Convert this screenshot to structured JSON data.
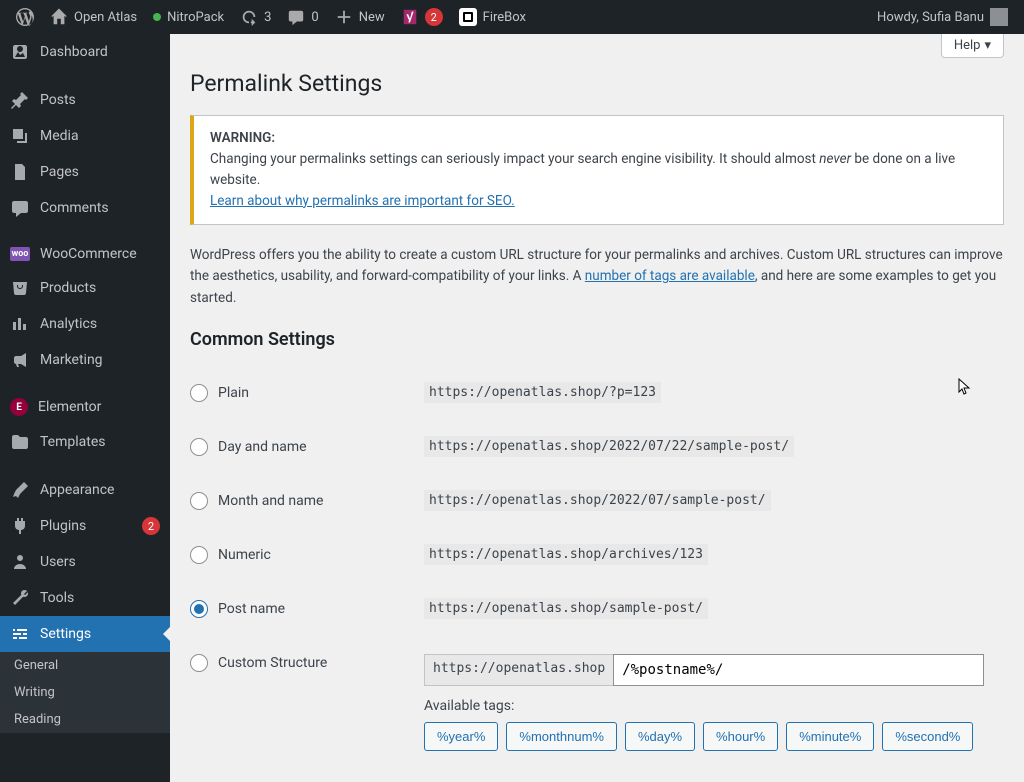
{
  "adminbar": {
    "site_name": "Open Atlas",
    "nitro": "NitroPack",
    "updates": "3",
    "comments": "0",
    "new": "New",
    "yoast_badge": "2",
    "firebox": "FireBox",
    "howdy": "Howdy, Sufia Banu"
  },
  "sidebar": {
    "dashboard": "Dashboard",
    "posts": "Posts",
    "media": "Media",
    "pages": "Pages",
    "comments": "Comments",
    "woocommerce": "WooCommerce",
    "products": "Products",
    "analytics": "Analytics",
    "marketing": "Marketing",
    "elementor": "Elementor",
    "templates": "Templates",
    "appearance": "Appearance",
    "plugins": "Plugins",
    "plugins_count": "2",
    "users": "Users",
    "tools": "Tools",
    "settings": "Settings",
    "sub_general": "General",
    "sub_writing": "Writing",
    "sub_reading": "Reading"
  },
  "content": {
    "help": "Help",
    "title": "Permalink Settings",
    "warning_label": "WARNING:",
    "warning_text_1": "Changing your permalinks settings can seriously impact your search engine visibility. It should almost ",
    "warning_em": "never",
    "warning_text_2": " be done on a live website.",
    "warning_link": "Learn about why permalinks are important for SEO.",
    "intro_1": "WordPress offers you the ability to create a custom URL structure for your permalinks and archives. Custom URL structures can improve the aesthetics, usability, and forward-compatibility of your links. A ",
    "intro_link": "number of tags are available",
    "intro_2": ", and here are some examples to get you started.",
    "common_heading": "Common Settings",
    "options": {
      "plain": {
        "label": "Plain",
        "code": "https://openatlas.shop/?p=123"
      },
      "day": {
        "label": "Day and name",
        "code": "https://openatlas.shop/2022/07/22/sample-post/"
      },
      "month": {
        "label": "Month and name",
        "code": "https://openatlas.shop/2022/07/sample-post/"
      },
      "numeric": {
        "label": "Numeric",
        "code": "https://openatlas.shop/archives/123"
      },
      "postname": {
        "label": "Post name",
        "code": "https://openatlas.shop/sample-post/"
      },
      "custom": {
        "label": "Custom Structure",
        "prefix": "https://openatlas.shop",
        "value": "/%postname%/"
      }
    },
    "available_tags_label": "Available tags:",
    "tags": [
      "%year%",
      "%monthnum%",
      "%day%",
      "%hour%",
      "%minute%",
      "%second%"
    ]
  }
}
